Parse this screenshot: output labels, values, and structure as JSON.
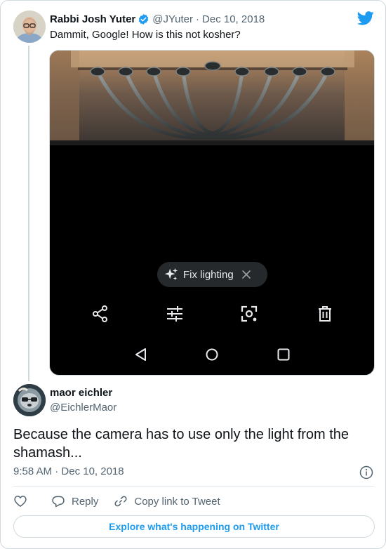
{
  "parent_tweet": {
    "author_name": "Rabbi Josh Yuter",
    "handle": "@JYuter",
    "separator": "·",
    "date": "Dec 10, 2018",
    "text": "Dammit, Google! How is this not kosher?",
    "media": {
      "chip_label": "Fix lighting",
      "chip_icon": "sparkle-icon",
      "toolbar_icons": [
        "share-icon",
        "adjust-sliders-icon",
        "lens-icon",
        "delete-icon"
      ],
      "nav_icons": [
        "back-triangle-icon",
        "home-circle-icon",
        "recents-square-icon"
      ]
    }
  },
  "reply": {
    "author_name": "maor eichler",
    "handle": "@EichlerMaor",
    "text": "Because the camera has to use only the light from the shamash...",
    "time": "9:58 AM",
    "separator": "·",
    "date": "Dec 10, 2018"
  },
  "actions": {
    "reply_label": "Reply",
    "copy_link_label": "Copy link to Tweet"
  },
  "explore_label": "Explore what's happening on Twitter",
  "colors": {
    "accent": "#1d9bf0",
    "secondary_text": "#536471",
    "border": "#cfd9de"
  }
}
